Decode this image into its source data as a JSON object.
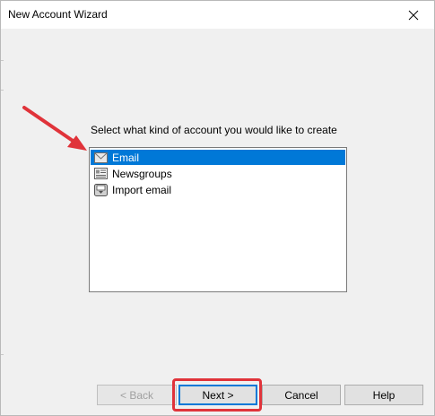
{
  "window": {
    "title": "New Account Wizard",
    "close_icon": "close-icon"
  },
  "main": {
    "instruction": "Select what kind of account you would like to create",
    "account_types": [
      {
        "label": "Email",
        "icon": "envelope-icon",
        "selected": true
      },
      {
        "label": "Newsgroups",
        "icon": "newsgroups-icon",
        "selected": false
      },
      {
        "label": "Import email",
        "icon": "import-tray-icon",
        "selected": false
      }
    ]
  },
  "buttons": {
    "back": "< Back",
    "next": "Next >",
    "cancel": "Cancel",
    "help": "Help"
  },
  "annotations": {
    "arrow_color": "#e0333a",
    "highlight_color": "#e0333a"
  },
  "colors": {
    "selection": "#0078d7",
    "window_bg": "#f0f0f0"
  }
}
